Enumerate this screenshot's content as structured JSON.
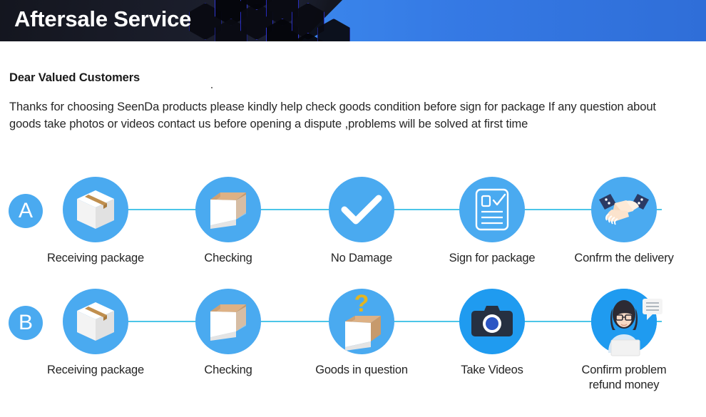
{
  "header": {
    "title": "Aftersale Service",
    "accent_dark": "#14161f",
    "accent_blue": "#3d8ef0",
    "hex_stroke": "#2b2fc9"
  },
  "intro": {
    "heading": "Dear Valued Customers",
    "body": "Thanks for choosing SeenDa products please kindly help check goods condition before sign for package If any question about goods take photos or videos contact us before opening a dispute ,problems will be solved at first time"
  },
  "theme": {
    "circle_blue": "#4aaaf0",
    "circle_blue_deep": "#1f9bf0",
    "track_line": "#4cc6e8",
    "box_tape": "#c08f4e",
    "box_inner": "#ddb185",
    "question_mark": "#e3b521",
    "camera_body": "#263041",
    "camera_lens": "#2b55c4",
    "suit_navy": "#2b3a63",
    "skin": "#f7dcc4",
    "text": "#242424"
  },
  "rows": [
    {
      "badge": "A",
      "name": "flow-row-a",
      "steps": [
        {
          "label": "Receiving package",
          "icon": "closed-box-icon"
        },
        {
          "label": "Checking",
          "icon": "open-box-icon"
        },
        {
          "label": "No Damage",
          "icon": "check-circle-icon"
        },
        {
          "label": "Sign for package",
          "icon": "clipboard-check-icon"
        },
        {
          "label": "Confrm the delivery",
          "icon": "handshake-icon"
        }
      ]
    },
    {
      "badge": "B",
      "name": "flow-row-b",
      "steps": [
        {
          "label": "Receiving package",
          "icon": "closed-box-icon"
        },
        {
          "label": "Checking",
          "icon": "open-box-icon"
        },
        {
          "label": "Goods in question",
          "icon": "question-box-icon"
        },
        {
          "label": "Take Videos",
          "icon": "camera-icon"
        },
        {
          "label": "Confirm problem",
          "label2": "refund money",
          "icon": "support-agent-icon"
        }
      ]
    }
  ]
}
